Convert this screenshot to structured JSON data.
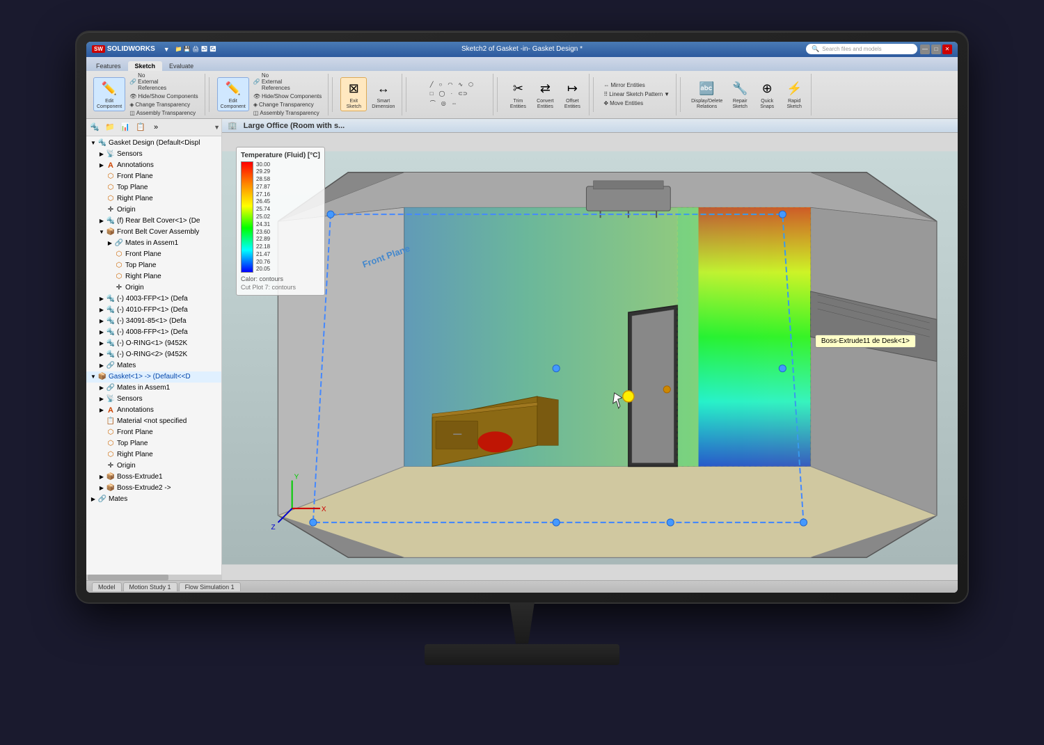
{
  "app": {
    "title": "Sketch2 of Gasket -in- Gasket Design *",
    "logo": "SW",
    "logo_brand": "SOLIDWORKS"
  },
  "title_bar": {
    "title": "Sketch2 of Gasket -in- Gasket Design *",
    "search_placeholder": "Search files and models",
    "search_icon": "🔍",
    "minimize": "—",
    "maximize": "□",
    "close": "✕"
  },
  "ribbon_tabs": [
    {
      "label": "Features",
      "active": false
    },
    {
      "label": "Sketch",
      "active": true
    },
    {
      "label": "Evaluate",
      "active": false
    }
  ],
  "ribbon": {
    "groups": [
      {
        "name": "component-group",
        "items": [
          {
            "label": "Edit\nComponent",
            "icon": "✏️",
            "active": true
          },
          {
            "label": "No\nExternal\nReferences",
            "icon": "🔗"
          },
          {
            "label": "Hide/Show Components",
            "icon": "👁"
          },
          {
            "label": "Change Transparency",
            "icon": "◈"
          },
          {
            "label": "Assembly Transparency",
            "icon": "◫"
          }
        ]
      },
      {
        "name": "sketch-group",
        "items": [
          {
            "label": "Edit\nComponent",
            "icon": "✏️",
            "active": true
          },
          {
            "label": "No\nExternal\nReferences",
            "icon": "🔗"
          },
          {
            "label": "Hide/Show Components",
            "icon": "👁"
          },
          {
            "label": "Change Transparency",
            "icon": "◈"
          },
          {
            "label": "Assembly Transparency",
            "icon": "◫"
          }
        ]
      },
      {
        "name": "exit-group",
        "items": [
          {
            "label": "Exit\nSketch",
            "icon": "⊠"
          },
          {
            "label": "Smart\nDimension",
            "icon": "↔"
          }
        ]
      }
    ]
  },
  "viewport": {
    "title": "Large Office  (Room with s...",
    "tooltip": "Boss-Extrude11 de Desk<1>",
    "front_plane_label": "Front Plane"
  },
  "color_legend": {
    "title": "Temperature (Fluid) [°C]",
    "values": [
      "30.00",
      "29.29",
      "28.58",
      "27.87",
      "27.16",
      "26.45",
      "25.74",
      "25.02",
      "24.31",
      "23.60",
      "22.89",
      "22.18",
      "21.47",
      "20.76",
      "20.05"
    ],
    "footer": "Calor: contours",
    "subtitle": "Cut Plot 7: contours"
  },
  "feature_tree": {
    "items": [
      {
        "label": "Gasket Design (Default<Displ",
        "level": 0,
        "icon": "📦",
        "expand": true
      },
      {
        "label": "Sensors",
        "level": 1,
        "icon": "📡"
      },
      {
        "label": "Annotations",
        "level": 1,
        "icon": "A"
      },
      {
        "label": "Front Plane",
        "level": 1,
        "icon": "⬜"
      },
      {
        "label": "Top Plane",
        "level": 1,
        "icon": "⬜"
      },
      {
        "label": "Right Plane",
        "level": 1,
        "icon": "⬜"
      },
      {
        "label": "Origin",
        "level": 1,
        "icon": "✛"
      },
      {
        "label": "(f) Rear Belt Cover<1> (De",
        "level": 1,
        "icon": "🔩"
      },
      {
        "label": "Front Belt Cover Assembly",
        "level": 1,
        "icon": "📦"
      },
      {
        "label": "Mates in Assem1",
        "level": 2,
        "icon": "🔗"
      },
      {
        "label": "Front Plane",
        "level": 2,
        "icon": "⬜"
      },
      {
        "label": "Top Plane",
        "level": 2,
        "icon": "⬜"
      },
      {
        "label": "Right Plane",
        "level": 2,
        "icon": "⬜"
      },
      {
        "label": "Origin",
        "level": 2,
        "icon": "✛"
      },
      {
        "label": "(-) 4003-FFP<1> (Defa",
        "level": 1,
        "icon": "🔩"
      },
      {
        "label": "(-) 4010-FFP<1> (Defa",
        "level": 1,
        "icon": "🔩"
      },
      {
        "label": "(-) 34091-85<1> (Defa",
        "level": 1,
        "icon": "🔩"
      },
      {
        "label": "(-) 4008-FFP<1> (Defa",
        "level": 1,
        "icon": "🔩"
      },
      {
        "label": "(-) O-RING<1> (9452K",
        "level": 1,
        "icon": "🔩"
      },
      {
        "label": "(-) O-RING<2> (9452K",
        "level": 1,
        "icon": "🔩"
      },
      {
        "label": "Mates",
        "level": 1,
        "icon": "🔗"
      },
      {
        "label": "Gasket<1> -> (Default<<D",
        "level": 0,
        "icon": "📦",
        "expand": true
      },
      {
        "label": "Mates in Assem1",
        "level": 1,
        "icon": "🔗"
      },
      {
        "label": "Sensors",
        "level": 1,
        "icon": "📡"
      },
      {
        "label": "Annotations",
        "level": 1,
        "icon": "A"
      },
      {
        "label": "Material <not specified",
        "level": 1,
        "icon": "📋"
      },
      {
        "label": "Front Plane",
        "level": 1,
        "icon": "⬜"
      },
      {
        "label": "Top Plane",
        "level": 1,
        "icon": "⬜"
      },
      {
        "label": "Right Plane",
        "level": 1,
        "icon": "⬜"
      },
      {
        "label": "Origin",
        "level": 1,
        "icon": "✛"
      },
      {
        "label": "Boss-Extrude1",
        "level": 1,
        "icon": "📦"
      },
      {
        "label": "Boss-Extrude2 ->",
        "level": 1,
        "icon": "📦"
      },
      {
        "label": "Mates",
        "level": 0,
        "icon": "🔗"
      }
    ]
  },
  "status_bar": {
    "tabs": [
      "Model",
      "Motion Study 1",
      "Flow Simulation 1"
    ]
  }
}
